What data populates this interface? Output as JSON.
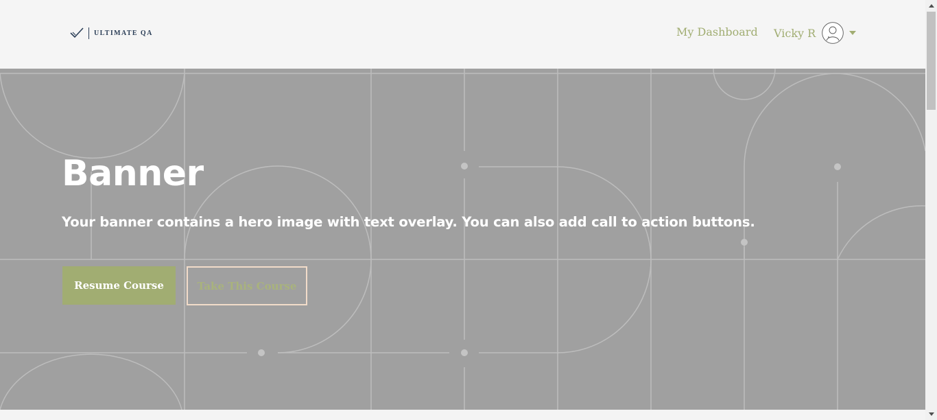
{
  "header": {
    "logo_text": "ULTIMATE QA",
    "nav_dashboard": "My Dashboard",
    "user_name": "Vicky R"
  },
  "banner": {
    "title": "Banner",
    "subtitle": "Your banner contains a hero image with text overlay. You can also add call to action buttons.",
    "primary_button": "Resume Course",
    "secondary_button": "Take This Course"
  },
  "icons": {
    "logo": "checkmark-icon",
    "avatar": "user-avatar-icon",
    "caret": "caret-down-icon",
    "scroll_up": "triangle-up-icon",
    "scroll_down": "triangle-down-icon"
  },
  "colors": {
    "accent": "#a1ad72",
    "banner_bg": "#a0a0a0",
    "secondary_border": "#f2dcc9",
    "logo": "#2b3e57"
  }
}
